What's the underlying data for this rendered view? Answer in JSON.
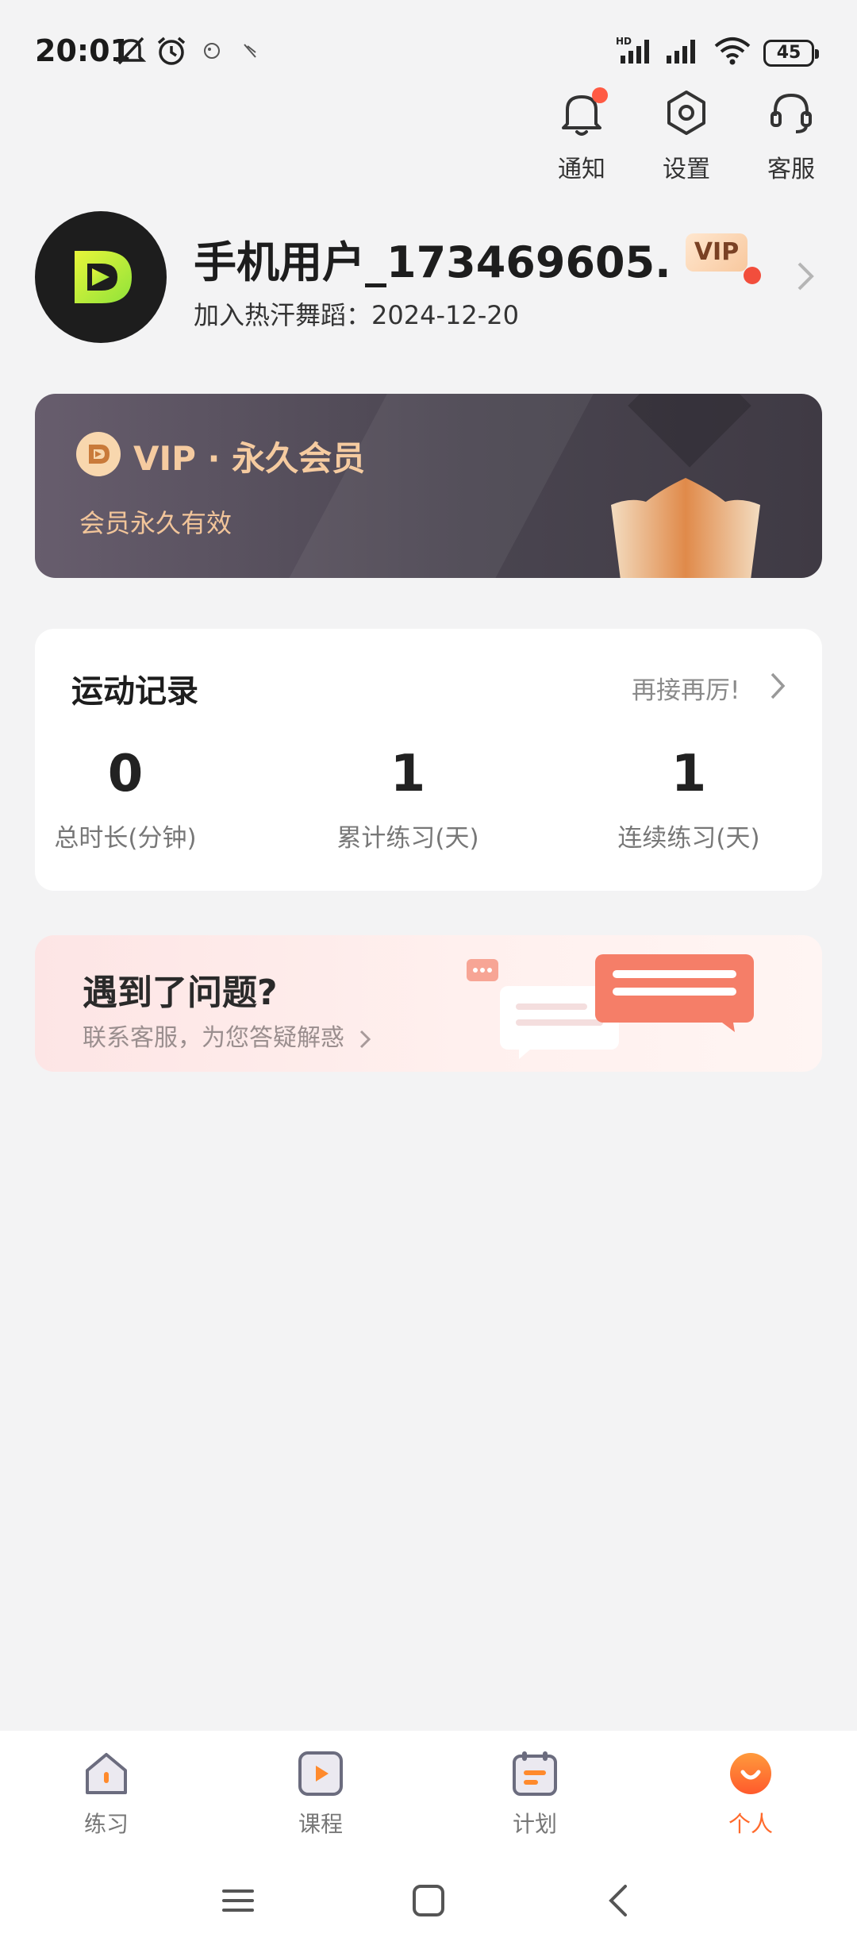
{
  "status_bar": {
    "time": "20:01",
    "battery": "45",
    "icons": [
      "mute-icon",
      "alarm-icon",
      "app-notification-icon",
      "app-notification-icon",
      "hd-signal-icon",
      "signal-icon",
      "wifi-icon",
      "battery-icon"
    ]
  },
  "top_actions": {
    "notify": {
      "label": "通知",
      "icon": "bell-icon",
      "has_dot": true
    },
    "settings": {
      "label": "设置",
      "icon": "hexagon-settings-icon"
    },
    "service": {
      "label": "客服",
      "icon": "headset-icon"
    }
  },
  "profile": {
    "name": "手机用户_173469605...",
    "vip_badge": "VIP",
    "join_label": "加入热汗舞蹈：2024-12-20"
  },
  "vip_card": {
    "title": "VIP · 永久会员",
    "subtitle": "会员永久有效"
  },
  "record": {
    "title": "运动记录",
    "link": "再接再厉!",
    "stats": [
      {
        "value": "0",
        "label": "总时长(分钟)"
      },
      {
        "value": "1",
        "label": "累计练习(天)"
      },
      {
        "value": "1",
        "label": "连续练习(天)"
      }
    ]
  },
  "help": {
    "title": "遇到了问题?",
    "subtitle": "联系客服，为您答疑解惑"
  },
  "bottom_nav": {
    "items": [
      {
        "label": "练习",
        "icon": "home-icon"
      },
      {
        "label": "课程",
        "icon": "play-icon"
      },
      {
        "label": "计划",
        "icon": "calendar-icon"
      },
      {
        "label": "个人",
        "icon": "profile-icon",
        "active": true
      }
    ]
  },
  "colors": {
    "accent": "#ff6a2c",
    "notification_dot": "#ff5a43",
    "vip_gold": "#f5cba0",
    "vip_card_bg": "#4a4550",
    "brand_green": "#c6f43a"
  }
}
